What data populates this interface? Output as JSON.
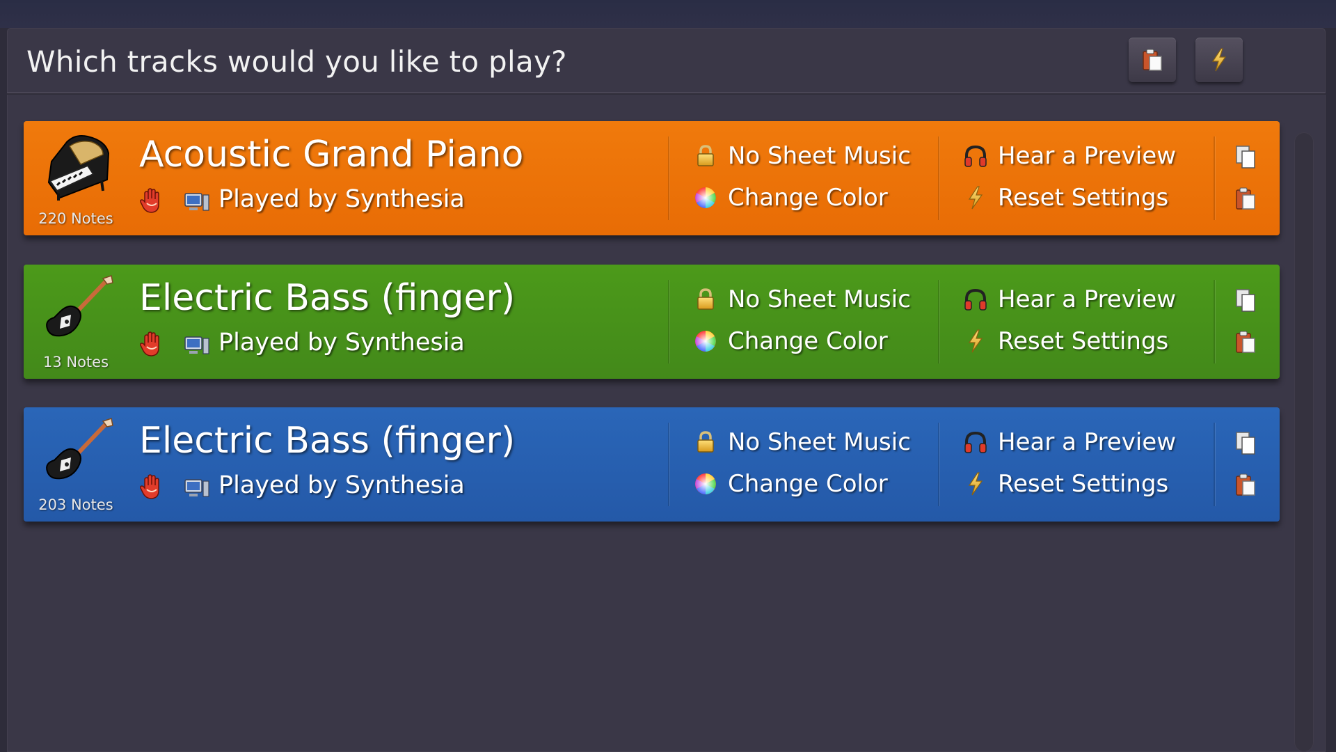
{
  "header": {
    "prompt": "Which tracks would you like to play?",
    "buttons": [
      {
        "icon": "paste-icon"
      },
      {
        "icon": "lightning-icon"
      }
    ]
  },
  "colors": {
    "track_orange": "#ec7208",
    "track_green": "#47911a",
    "track_blue": "#2760b0",
    "panel_bg": "#3a3747"
  },
  "tracks": [
    {
      "name": "Acoustic Grand Piano",
      "notes": "220 Notes",
      "instrument_icon": "grand-piano-icon",
      "player": "Played by Synthesia",
      "sheet": "No Sheet Music",
      "color_action": "Change Color",
      "preview": "Hear a Preview",
      "reset": "Reset Settings"
    },
    {
      "name": "Electric Bass (finger)",
      "notes": "13 Notes",
      "instrument_icon": "guitar-icon",
      "player": "Played by Synthesia",
      "sheet": "No Sheet Music",
      "color_action": "Change Color",
      "preview": "Hear a Preview",
      "reset": "Reset Settings"
    },
    {
      "name": "Electric Bass (finger)",
      "notes": "203 Notes",
      "instrument_icon": "guitar-icon",
      "player": "Played by Synthesia",
      "sheet": "No Sheet Music",
      "color_action": "Change Color",
      "preview": "Hear a Preview",
      "reset": "Reset Settings"
    }
  ]
}
